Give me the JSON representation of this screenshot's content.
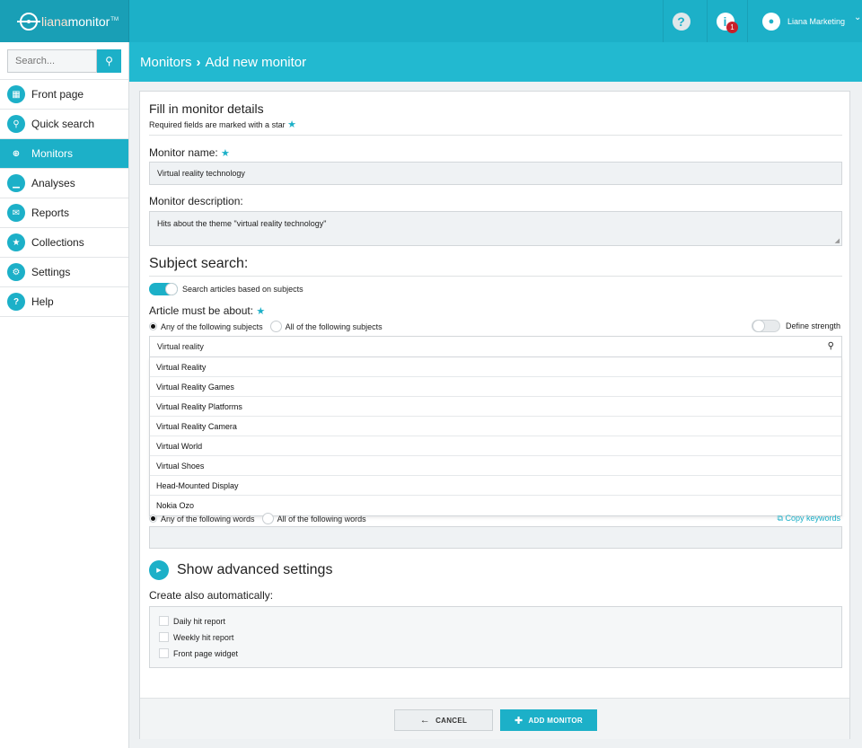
{
  "brand": {
    "logo_part1": "liana",
    "logo_part2": "monitor",
    "logo_tm": "TM"
  },
  "topbar": {
    "help_icon": "?",
    "info_icon": "i",
    "notification_count": "1",
    "user_name": "Liana Marketing"
  },
  "sidebar": {
    "search_placeholder": "Search...",
    "items": [
      {
        "label": "Front page",
        "icon": "grid-icon"
      },
      {
        "label": "Quick search",
        "icon": "search-icon"
      },
      {
        "label": "Monitors",
        "icon": "crosshair-icon"
      },
      {
        "label": "Analyses",
        "icon": "chart-icon"
      },
      {
        "label": "Reports",
        "icon": "envelope-icon"
      },
      {
        "label": "Collections",
        "icon": "star-icon"
      },
      {
        "label": "Settings",
        "icon": "gears-icon"
      },
      {
        "label": "Help",
        "icon": "question-icon"
      }
    ]
  },
  "header": {
    "crumb1": "Monitors",
    "separator": "›",
    "crumb2": "Add new monitor"
  },
  "form": {
    "title": "Fill in monitor details",
    "required_note": "Required fields are marked with a star",
    "name_label": "Monitor name:",
    "name_value": "Virtual reality technology",
    "description_label": "Monitor description:",
    "description_value": "Hits about the theme \"virtual reality technology\"",
    "subject_title": "Subject search:",
    "subject_toggle_label": "Search articles based on subjects",
    "about_label": "Article must be about:",
    "any_subjects": "Any of the following subjects",
    "all_subjects": "All of the following subjects",
    "define_strength": "Define strength",
    "subject_query": "Virtual reality",
    "suggestions": [
      "Virtual Reality",
      "Virtual Reality Games",
      "Virtual Reality Platforms",
      "Virtual Reality Camera",
      "Virtual World",
      "Virtual Shoes",
      "Head-Mounted Display",
      "Nokia Ozo"
    ],
    "any_words": "Any of the following words",
    "all_words": "All of the following words",
    "copy_keywords": "Copy keywords",
    "advanced": "Show advanced settings",
    "create_auto_label": "Create also automatically:",
    "auto_options": [
      "Daily hit report",
      "Weekly hit report",
      "Front page widget"
    ]
  },
  "footer": {
    "cancel": "CANCEL",
    "add": "ADD MONITOR"
  },
  "colors": {
    "accent": "#1cb0c8",
    "header_band": "#22b9d0",
    "badge": "#c8202a"
  }
}
